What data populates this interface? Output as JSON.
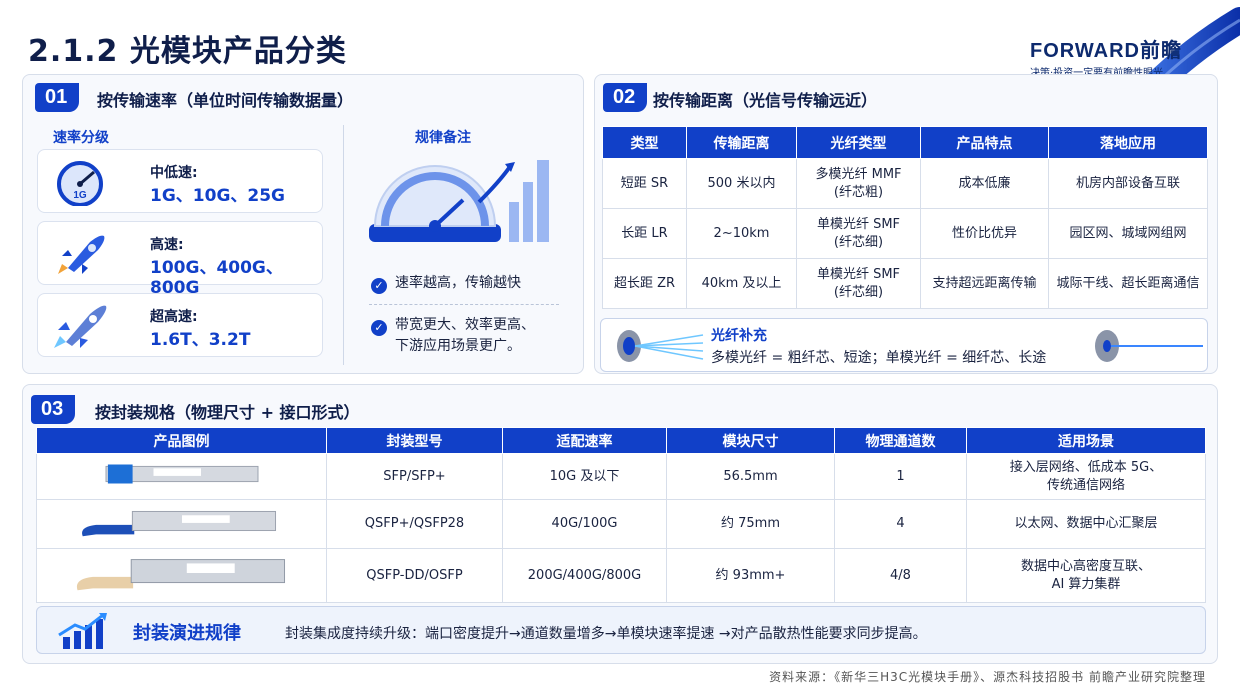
{
  "page_title": "2.1.2 光模块产品分类",
  "logo": {
    "main": "FORWARD前瞻",
    "tagline": "决策·投资一定要有前瞻性眼光"
  },
  "section1": {
    "number": "01",
    "title": "按传输速率（单位时间传输数据量）",
    "rate_heading": "速率分级",
    "gauge_label": "1G",
    "levels": [
      {
        "label": "中低速:",
        "value": "1G、10G、25G"
      },
      {
        "label": "高速:",
        "value": "100G、400G、800G"
      },
      {
        "label": "超高速:",
        "value": "1.6T、3.2T"
      }
    ],
    "notes_heading": "规律备注",
    "notes": [
      {
        "line1": "速率越高，传输越快",
        "line2": ""
      },
      {
        "line1": "带宽更大、效率更高、",
        "line2": "下游应用场景更广。"
      }
    ]
  },
  "section2": {
    "number": "02",
    "title": "按传输距离（光信号传输远近）",
    "headers": [
      "类型",
      "传输距离",
      "光纤类型",
      "产品特点",
      "落地应用"
    ],
    "rows": [
      {
        "type": "短距 SR",
        "distance": "500 米以内",
        "fiber1": "多模光纤 MMF",
        "fiber2": "(纤芯粗)",
        "feature": "成本低廉",
        "application": "机房内部设备互联"
      },
      {
        "type": "长距 LR",
        "distance": "2~10km",
        "fiber1": "单模光纤 SMF",
        "fiber2": "(纤芯细)",
        "feature": "性价比优异",
        "application": "园区网、城域网组网"
      },
      {
        "type": "超长距 ZR",
        "distance": "40km 及以上",
        "fiber1": "单模光纤 SMF",
        "fiber2": "(纤芯细)",
        "feature": "支持超远距离传输",
        "application": "城际干线、超长距离通信"
      }
    ],
    "supplement_title": "光纤补充",
    "supplement_text": "多模光纤 = 粗纤芯、短途；单模光纤 = 细纤芯、长途"
  },
  "section3": {
    "number": "03",
    "title": "按封装规格（物理尺寸 + 接口形式）",
    "headers": [
      "产品图例",
      "封装型号",
      "适配速率",
      "模块尺寸",
      "物理通道数",
      "适用场景"
    ],
    "rows": [
      {
        "package": "SFP/SFP+",
        "rate": "10G 及以下",
        "size": "56.5mm",
        "channels": "1",
        "scene1": "接入层网络、低成本 5G、",
        "scene2": "传统通信网络"
      },
      {
        "package": "QSFP+/QSFP28",
        "rate": "40G/100G",
        "size": "约 75mm",
        "channels": "4",
        "scene1": "以太网、数据中心汇聚层",
        "scene2": ""
      },
      {
        "package": "QSFP-DD/OSFP",
        "rate": "200G/400G/800G",
        "size": "约 93mm+",
        "channels": "4/8",
        "scene1": "数据中心高密度互联、",
        "scene2": "AI 算力集群"
      }
    ],
    "evolution_title": "封装演进规律",
    "evolution_text": "封装集成度持续升级：端口密度提升→通道数量增多→单模块速率提速 →对产品散热性能要求同步提高。"
  },
  "source": "资料来源：《新华三H3C光模块手册》、源杰科技招股书 前瞻产业研究院整理",
  "colors": {
    "primary": "#1140c8",
    "title": "#0f1e4a",
    "panel_bg": "#f7f9fd"
  }
}
